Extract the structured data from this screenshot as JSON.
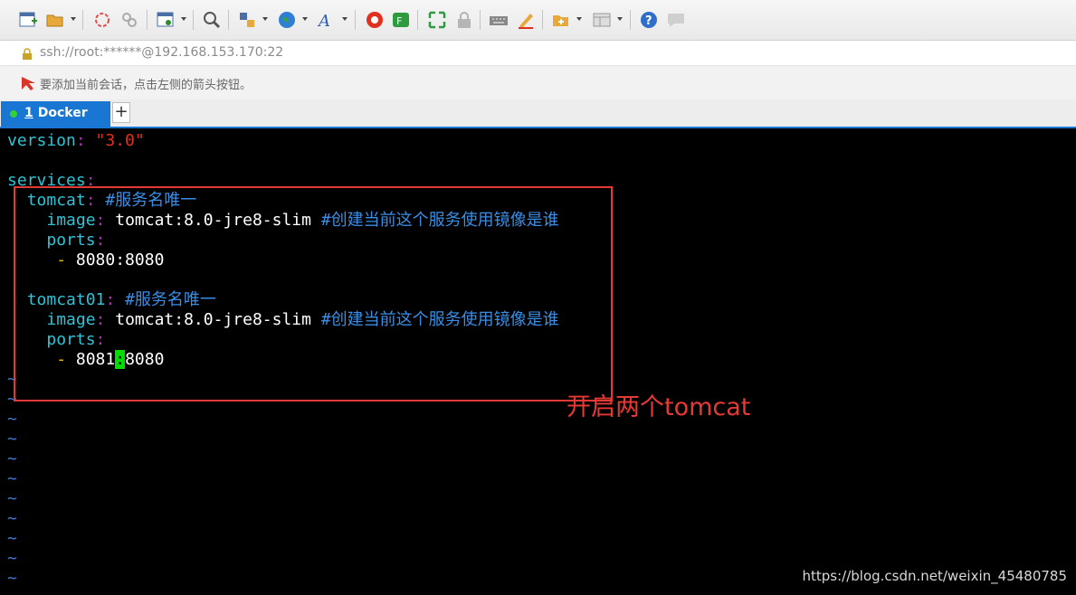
{
  "toolbar": {
    "icons": [
      "new-session-icon",
      "open-folder-icon",
      "reconnect-icon",
      "disconnect-icon",
      "properties-icon",
      "find-icon",
      "transfer-icon",
      "globe-icon",
      "font-icon",
      "xftp-icon",
      "xshell-green-icon",
      "fullscreen-icon",
      "lock-icon",
      "keyboard-icon",
      "highlight-pen-icon",
      "new-tab-group-icon",
      "layout-icon",
      "help-icon",
      "chat-icon"
    ]
  },
  "address": {
    "text": "ssh://root:******@192.168.153.170:22"
  },
  "hint": {
    "text": "要添加当前会话，点击左侧的箭头按钮。"
  },
  "tabs": [
    {
      "number": "1",
      "label": "Docker"
    }
  ],
  "tab_add_label": "+",
  "terminal": {
    "version_key": "version",
    "version_value": "\"3.0\"",
    "services_key": "services",
    "svc1": {
      "name": "tomcat",
      "comment": "#服务名唯一",
      "image_key": "image",
      "image_value": "tomcat:8.0-jre8-slim",
      "image_comment": "#创建当前这个服务使用镜像是谁",
      "ports_key": "ports",
      "port": "8080:8080"
    },
    "svc2": {
      "name": "tomcat01",
      "comment": "#服务名唯一",
      "image_key": "image",
      "image_value": "tomcat:8.0-jre8-slim",
      "image_comment": "#创建当前这个服务使用镜像是谁",
      "ports_key": "ports",
      "port_before_cursor": "8081",
      "port_cursor": ":",
      "port_after_cursor": "8080"
    },
    "tilde": "~"
  },
  "annotation": {
    "text": "开启两个tomcat"
  },
  "watermark": {
    "text": "https://blog.csdn.net/weixin_45480785"
  },
  "colors": {
    "accent": "#1976d2",
    "annotation": "#e53935",
    "cursor": "#00dd00"
  }
}
